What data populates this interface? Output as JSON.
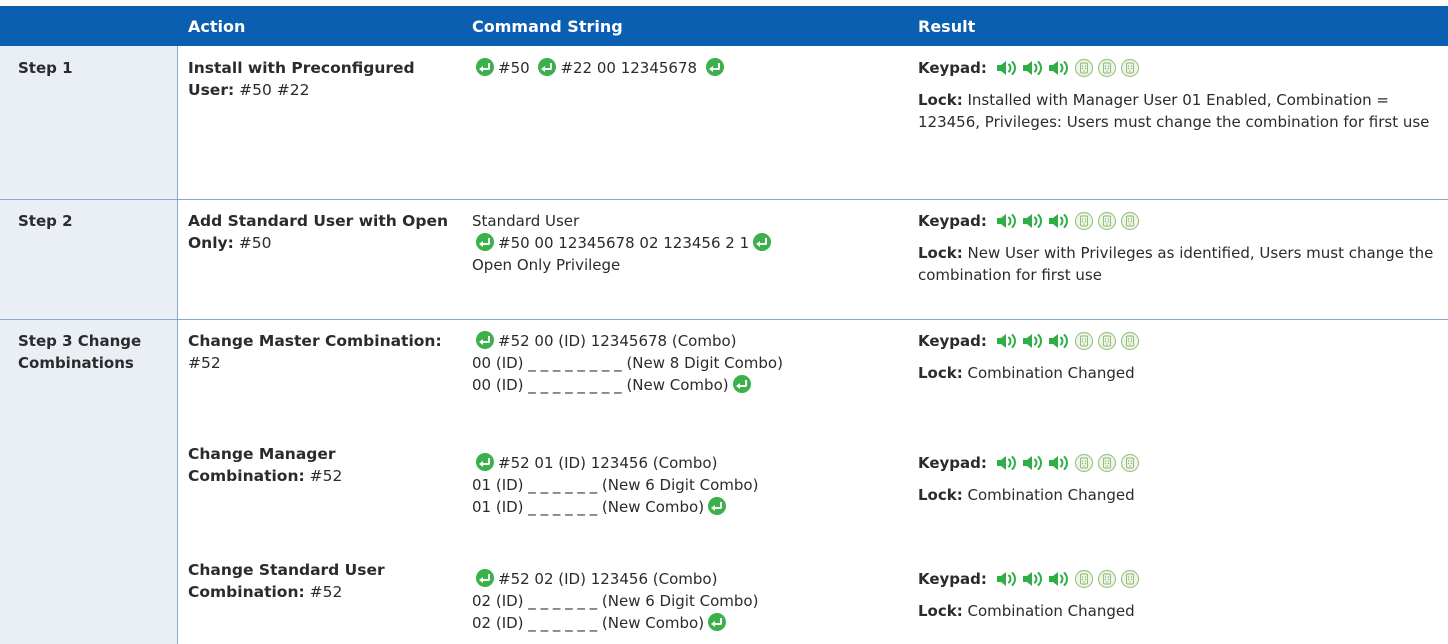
{
  "header": {
    "action": "Action",
    "command": "Command String",
    "result": "Result"
  },
  "rows": [
    {
      "step": "Step 1",
      "action_bold": "Install with Preconfigured User:",
      "action_tail": " #50 #22",
      "cmd_line1": "#50",
      "cmd_line1b": "#22  00  12345678",
      "keypad_label": "Keypad:",
      "lock_label": "Lock:",
      "lock_text": " Installed with Manager User 01 Enabled, Combination = 123456, Privileges: Users must change the combination for first use"
    },
    {
      "step": "Step 2",
      "action_bold": "Add Standard User with Open Only:",
      "action_tail": " #50",
      "cmd_pre": "Standard User",
      "cmd_main": "#50  00  12345678  02  123456  2  1",
      "cmd_post": "Open Only Privilege",
      "keypad_label": "Keypad:",
      "lock_label": "Lock:",
      "lock_text": " New User with Privileges as identified, Users must change the combination for first use"
    },
    {
      "step": "Step 3 Change Combinations",
      "sub": [
        {
          "action_bold": "Change Master Combination:",
          "action_tail": " #52",
          "l1": "#52  00 (ID)  12345678 (Combo)",
          "l2": "00 (ID)  _ _ _ _ _ _ _ _ (New 8 Digit Combo)",
          "l3": "00 (ID)  _ _ _ _ _ _ _ _ (New Combo)",
          "keypad_label": "Keypad:",
          "lock_label": "Lock:",
          "lock_text": " Combination Changed"
        },
        {
          "action_bold": "Change Manager Combination:",
          "action_tail": " #52",
          "l1": "#52  01 (ID)  123456 (Combo)",
          "l2": "01 (ID)  _ _ _ _ _ _ (New 6 Digit Combo)",
          "l3": "01 (ID)  _ _ _ _ _ _ (New Combo)",
          "keypad_label": "Keypad:",
          "lock_label": "Lock:",
          "lock_text": " Combination Changed"
        },
        {
          "action_bold": "Change Standard User Combination:",
          "action_tail": " #52",
          "l1": "#52  02 (ID)  123456 (Combo)",
          "l2": "02 (ID)  _ _ _ _ _ _ (New 6 Digit Combo)",
          "l3": "02 (ID)  _ _ _ _ _ _ (New Combo)",
          "keypad_label": "Keypad:",
          "lock_label": "Lock:",
          "lock_text": " Combination Changed"
        }
      ]
    }
  ],
  "icons": {
    "enter": "enter-key-icon",
    "beep": "speaker-beep-icon",
    "led": "keypad-led-icon"
  },
  "colors": {
    "header_bg": "#0b5fb0",
    "step_col_bg": "#eaeff6",
    "enter_green": "#3bb04b",
    "beep_green": "#2fae46"
  }
}
